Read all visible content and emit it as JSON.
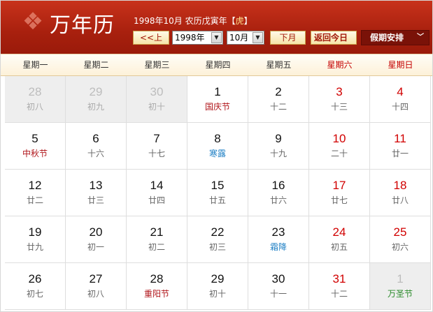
{
  "header": {
    "logo_title": "万年历",
    "logo_icon": "tiger-emblem-icon",
    "info_prefix": "1998年10月 农历戊寅年【",
    "zodiac": "虎",
    "info_suffix": "】"
  },
  "controls": {
    "prev_label": "<<上月",
    "year_value": "1998年",
    "month_value": "10月",
    "next_label": "下月>>",
    "today_label": "返回今日",
    "holiday_label": "假期安排",
    "holiday_chevron": "﹀"
  },
  "colors": {
    "header": "#b02812",
    "weekend": "#d10000",
    "festival": "#b0151a",
    "solar_term": "#1d7fc4",
    "foreign_festival": "#2a8a2a"
  },
  "weekdays": [
    {
      "label": "星期一",
      "weekend": false
    },
    {
      "label": "星期二",
      "weekend": false
    },
    {
      "label": "星期三",
      "weekend": false
    },
    {
      "label": "星期四",
      "weekend": false
    },
    {
      "label": "星期五",
      "weekend": false
    },
    {
      "label": "星期六",
      "weekend": true
    },
    {
      "label": "星期日",
      "weekend": true
    }
  ],
  "weeks": [
    [
      {
        "day": "28",
        "sub": "初八",
        "dim": true,
        "kind": "lunar"
      },
      {
        "day": "29",
        "sub": "初九",
        "dim": true,
        "kind": "lunar"
      },
      {
        "day": "30",
        "sub": "初十",
        "dim": true,
        "kind": "lunar"
      },
      {
        "day": "1",
        "sub": "国庆节",
        "dim": false,
        "kind": "festival"
      },
      {
        "day": "2",
        "sub": "十二",
        "dim": false,
        "kind": "lunar"
      },
      {
        "day": "3",
        "sub": "十三",
        "dim": false,
        "kind": "lunar"
      },
      {
        "day": "4",
        "sub": "十四",
        "dim": false,
        "kind": "lunar"
      }
    ],
    [
      {
        "day": "5",
        "sub": "中秋节",
        "dim": false,
        "kind": "festival"
      },
      {
        "day": "6",
        "sub": "十六",
        "dim": false,
        "kind": "lunar"
      },
      {
        "day": "7",
        "sub": "十七",
        "dim": false,
        "kind": "lunar"
      },
      {
        "day": "8",
        "sub": "寒露",
        "dim": false,
        "kind": "solar"
      },
      {
        "day": "9",
        "sub": "十九",
        "dim": false,
        "kind": "lunar"
      },
      {
        "day": "10",
        "sub": "二十",
        "dim": false,
        "kind": "lunar"
      },
      {
        "day": "11",
        "sub": "廿一",
        "dim": false,
        "kind": "lunar"
      }
    ],
    [
      {
        "day": "12",
        "sub": "廿二",
        "dim": false,
        "kind": "lunar"
      },
      {
        "day": "13",
        "sub": "廿三",
        "dim": false,
        "kind": "lunar"
      },
      {
        "day": "14",
        "sub": "廿四",
        "dim": false,
        "kind": "lunar"
      },
      {
        "day": "15",
        "sub": "廿五",
        "dim": false,
        "kind": "lunar"
      },
      {
        "day": "16",
        "sub": "廿六",
        "dim": false,
        "kind": "lunar"
      },
      {
        "day": "17",
        "sub": "廿七",
        "dim": false,
        "kind": "lunar"
      },
      {
        "day": "18",
        "sub": "廿八",
        "dim": false,
        "kind": "lunar"
      }
    ],
    [
      {
        "day": "19",
        "sub": "廿九",
        "dim": false,
        "kind": "lunar"
      },
      {
        "day": "20",
        "sub": "初一",
        "dim": false,
        "kind": "lunar"
      },
      {
        "day": "21",
        "sub": "初二",
        "dim": false,
        "kind": "lunar"
      },
      {
        "day": "22",
        "sub": "初三",
        "dim": false,
        "kind": "lunar"
      },
      {
        "day": "23",
        "sub": "霜降",
        "dim": false,
        "kind": "solar"
      },
      {
        "day": "24",
        "sub": "初五",
        "dim": false,
        "kind": "lunar"
      },
      {
        "day": "25",
        "sub": "初六",
        "dim": false,
        "kind": "lunar"
      }
    ],
    [
      {
        "day": "26",
        "sub": "初七",
        "dim": false,
        "kind": "lunar"
      },
      {
        "day": "27",
        "sub": "初八",
        "dim": false,
        "kind": "lunar"
      },
      {
        "day": "28",
        "sub": "重阳节",
        "dim": false,
        "kind": "festival"
      },
      {
        "day": "29",
        "sub": "初十",
        "dim": false,
        "kind": "lunar"
      },
      {
        "day": "30",
        "sub": "十一",
        "dim": false,
        "kind": "lunar"
      },
      {
        "day": "31",
        "sub": "十二",
        "dim": false,
        "kind": "lunar"
      },
      {
        "day": "1",
        "sub": "万圣节",
        "dim": true,
        "kind": "foreign"
      }
    ]
  ]
}
